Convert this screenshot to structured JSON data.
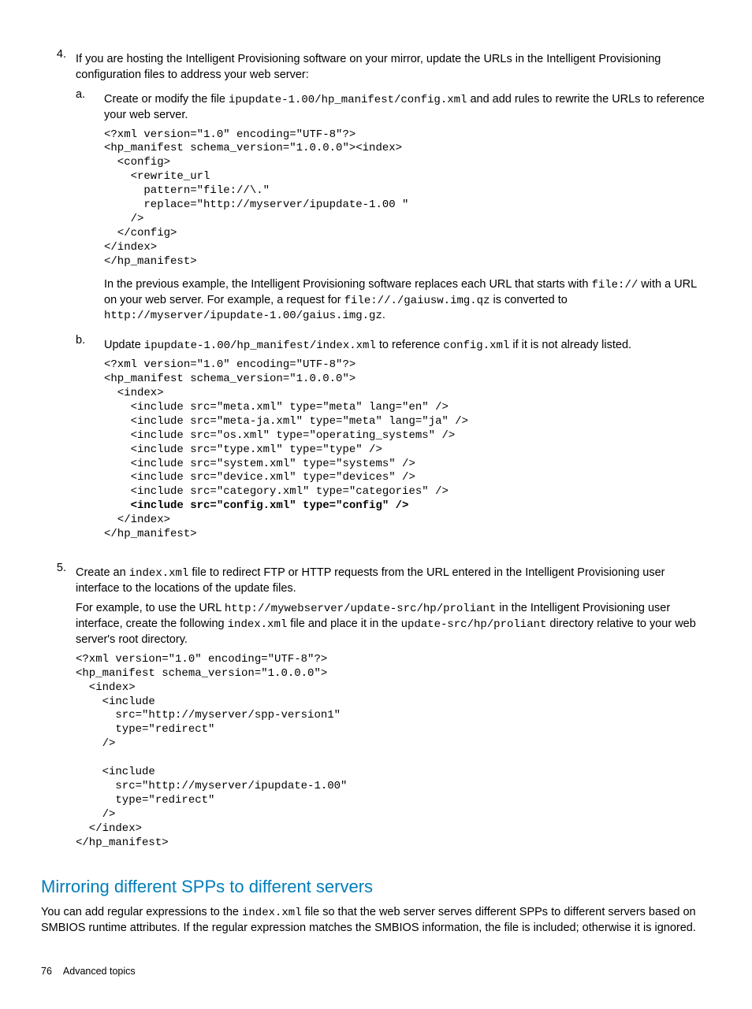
{
  "step4": {
    "num": "4.",
    "intro": "If you are hosting the Intelligent Provisioning software on your mirror, update the URLs in the Intelligent Provisioning configuration files to address your web server:",
    "a": {
      "letter": "a.",
      "lead1": "Create or modify the file ",
      "path": "ipupdate-1.00/hp_manifest/config.xml",
      "lead2": " and add rules to rewrite the URLs to reference your web server.",
      "code": "<?xml version=\"1.0\" encoding=\"UTF-8\"?>\n<hp_manifest schema_version=\"1.0.0.0\"><index>\n  <config>\n    <rewrite_url\n      pattern=\"file://\\.\"\n      replace=\"http://myserver/ipupdate-1.00 \"\n    />\n  </config>\n</index>\n</hp_manifest>",
      "expl_pre": "In the previous example, the Intelligent Provisioning software replaces each URL that starts with ",
      "expl_c1": "file://",
      "expl_mid1": " with a URL on your web server. For example, a request for ",
      "expl_c2": "file://./gaiusw.img.qz",
      "expl_mid2": " is converted to ",
      "expl_c3": "http://myserver/ipupdate-1.00/gaius.img.gz",
      "expl_end": "."
    },
    "b": {
      "letter": "b.",
      "lead1": "Update ",
      "path1": "ipupdate-1.00/hp_manifest/index.xml",
      "lead2": " to reference ",
      "path2": "config.xml",
      "lead3": " if it is not already listed.",
      "code_pre": "<?xml version=\"1.0\" encoding=\"UTF-8\"?>\n<hp_manifest schema_version=\"1.0.0.0\">\n  <index>\n    <include src=\"meta.xml\" type=\"meta\" lang=\"en\" />\n    <include src=\"meta-ja.xml\" type=\"meta\" lang=\"ja\" />\n    <include src=\"os.xml\" type=\"operating_systems\" />\n    <include src=\"type.xml\" type=\"type\" />\n    <include src=\"system.xml\" type=\"systems\" />\n    <include src=\"device.xml\" type=\"devices\" />\n    <include src=\"category.xml\" type=\"categories\" />",
      "code_bold": "    <include src=\"config.xml\" type=\"config\" />",
      "code_post": "  </index>\n</hp_manifest>"
    }
  },
  "step5": {
    "num": "5.",
    "p1a": "Create an ",
    "p1_code": "index.xml",
    "p1b": " file to redirect FTP or HTTP requests from the URL entered in the Intelligent Provisioning user interface to the locations of the update files.",
    "p2a": "For example, to use the URL ",
    "p2_code1": "http://mywebserver/update-src/hp/proliant",
    "p2b": " in the Intelligent Provisioning user interface, create the following ",
    "p2_code2": "index.xml",
    "p2c": " file and place it in the ",
    "p2_code3": "update-src/hp/proliant",
    "p2d": " directory relative to your web server's root directory.",
    "code": "<?xml version=\"1.0\" encoding=\"UTF-8\"?>\n<hp_manifest schema_version=\"1.0.0.0\">\n  <index>\n    <include\n      src=\"http://myserver/spp-version1\"\n      type=\"redirect\"\n    />\n\n    <include\n      src=\"http://myserver/ipupdate-1.00\"\n      type=\"redirect\"\n    />\n  </index>\n</hp_manifest>"
  },
  "section": {
    "heading": "Mirroring different SPPs to different servers",
    "p1a": "You can add regular expressions to the ",
    "p1_code": "index.xml",
    "p1b": " file so that the web server serves different SPPs to different servers based on SMBIOS runtime attributes. If the regular expression matches the SMBIOS information, the file is included; otherwise it is ignored."
  },
  "footer": {
    "page": "76",
    "title": "Advanced topics"
  }
}
